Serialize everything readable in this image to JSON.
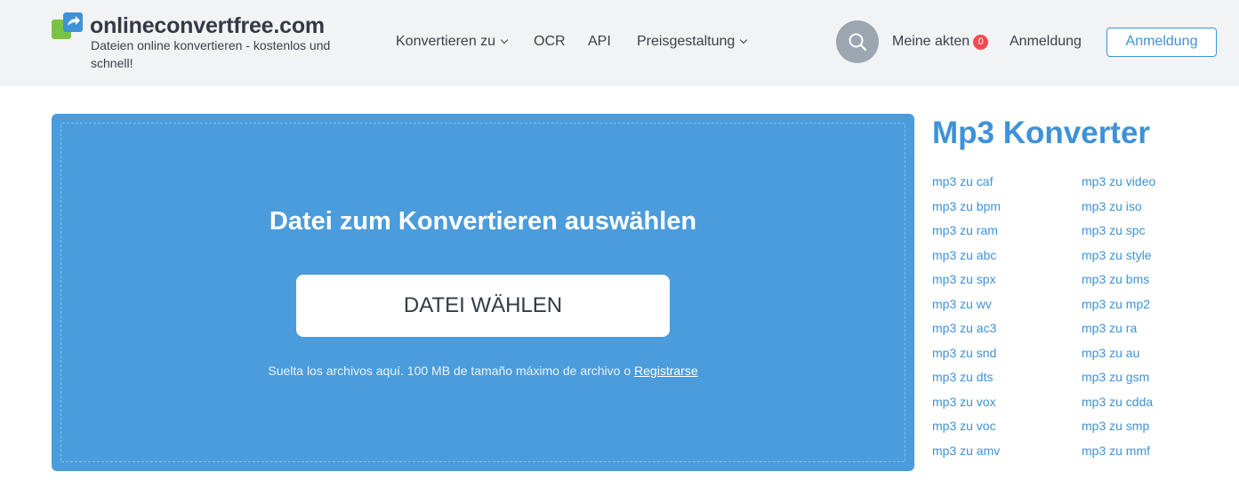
{
  "header": {
    "logo_name": "onlineconvertfree.com",
    "tagline": "Dateien online konvertieren - kostenlos und schnell!",
    "nav": {
      "convert_to": "Konvertieren zu",
      "ocr": "OCR",
      "api": "API",
      "pricing": "Preisgestaltung"
    },
    "my_files_label": "Meine akten",
    "my_files_count": "0",
    "signin_link": "Anmeldung",
    "signin_button": "Anmeldung"
  },
  "dropzone": {
    "title": "Datei zum Konvertieren auswählen",
    "button": "DATEI WÄHLEN",
    "hint": "Suelta los archivos aquí. 100 MB de tamaño máximo de archivo o ",
    "register_link": "Registrarse"
  },
  "sidebar": {
    "title": "Mp3 Konverter",
    "left": [
      "mp3 zu caf",
      "mp3 zu bpm",
      "mp3 zu ram",
      "mp3 zu abc",
      "mp3 zu spx",
      "mp3 zu wv",
      "mp3 zu ac3",
      "mp3 zu snd",
      "mp3 zu dts",
      "mp3 zu vox",
      "mp3 zu voc",
      "mp3 zu amv"
    ],
    "right": [
      "mp3 zu video",
      "mp3 zu iso",
      "mp3 zu spc",
      "mp3 zu style",
      "mp3 zu bms",
      "mp3 zu mp2",
      "mp3 zu ra",
      "mp3 zu au",
      "mp3 zu gsm",
      "mp3 zu cdda",
      "mp3 zu smp",
      "mp3 zu mmf"
    ]
  },
  "colors": {
    "accent": "#3d92d8",
    "dropzone": "#4a9cdc",
    "badge": "#ef4b51",
    "header_bg": "#f2f3f5"
  },
  "icons": [
    "logo-icon",
    "chevron-down-icon",
    "search-icon"
  ]
}
